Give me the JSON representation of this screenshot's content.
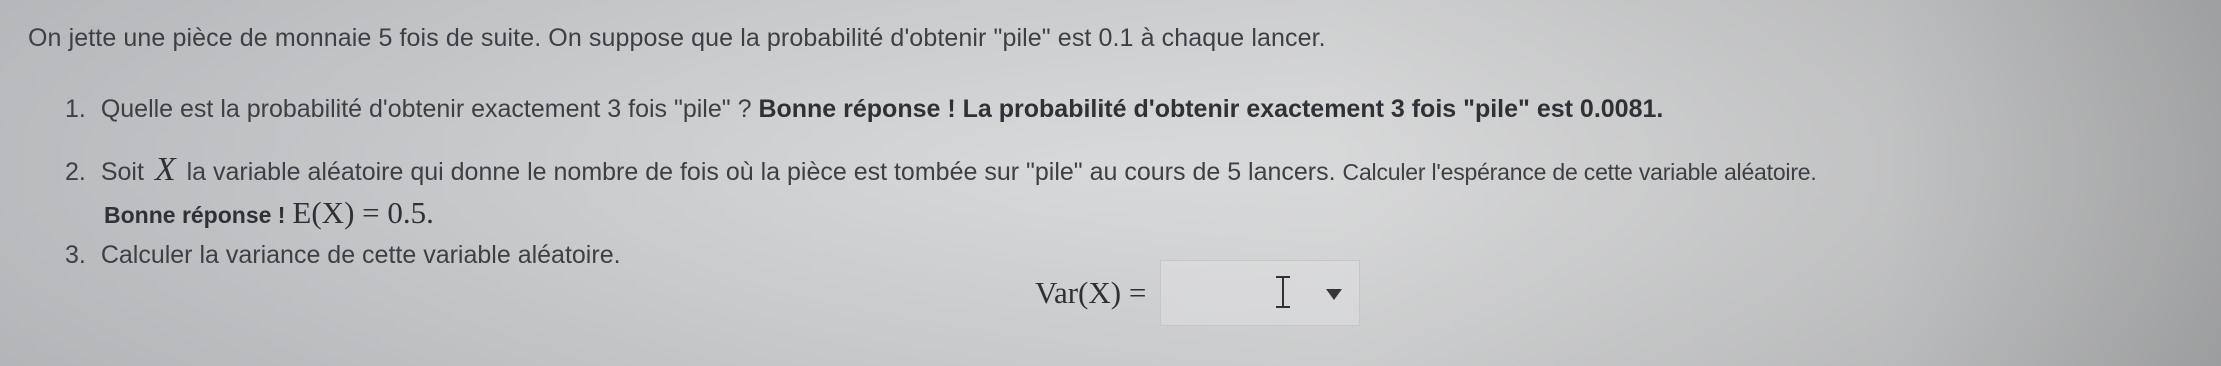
{
  "exercise": {
    "intro": "On jette une pièce de monnaie 5 fois de suite. On suppose que la probabilité d'obtenir \"pile\" est 0.1 à chaque lancer.",
    "questions": [
      {
        "number": "1.",
        "text": "Quelle est la probabilité d'obtenir exactement 3 fois \"pile\" ?",
        "feedback": "Bonne réponse ! La probabilité d'obtenir exactement 3 fois \"pile\" est 0.0081."
      },
      {
        "number": "2.",
        "text_before": "Soit",
        "variable": "X",
        "text_after": "la variable aléatoire qui donne le nombre de fois où la pièce est tombée sur \"pile\" au cours de 5 lancers.",
        "text_tail": "Calculer l'espérance de cette variable aléatoire.",
        "feedback_label": "Bonne réponse !",
        "feedback_math": "E(X) = 0.5."
      },
      {
        "number": "3.",
        "text": "Calculer la variance de cette variable aléatoire."
      }
    ],
    "answer": {
      "label": "Var(X) =",
      "value": "",
      "cursor_icon": "text-cursor-icon",
      "dropdown_icon": "chevron-down-icon"
    }
  }
}
